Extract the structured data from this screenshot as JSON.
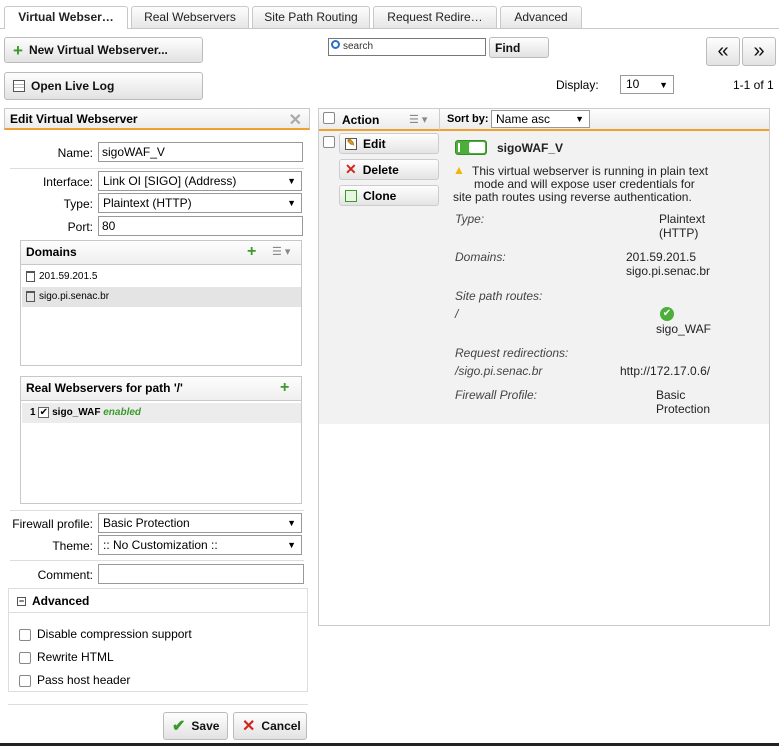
{
  "tabs": [
    {
      "label": "Virtual Webser…",
      "active": true
    },
    {
      "label": "Real Webservers",
      "active": false
    },
    {
      "label": "Site Path Routing",
      "active": false
    },
    {
      "label": "Request Redire…",
      "active": false
    },
    {
      "label": "Advanced",
      "active": false
    }
  ],
  "toolbar": {
    "new_label": "New Virtual Webserver...",
    "search_placeholder": "search",
    "find_label": "Find",
    "prev_label": "«",
    "next_label": "»",
    "live_log_label": "Open Live Log",
    "display_label": "Display:",
    "display_value": "10",
    "range_text": "1-1 of 1"
  },
  "edit": {
    "title": "Edit Virtual Webserver",
    "name_label": "Name:",
    "name_value": "sigoWAF_V",
    "interface_label": "Interface:",
    "interface_value": "Link OI [SIGO] (Address)",
    "type_label": "Type:",
    "type_value": "Plaintext (HTTP)",
    "port_label": "Port:",
    "port_value": "80",
    "domains_title": "Domains",
    "domains": [
      "201.59.201.5",
      "sigo.pi.senac.br"
    ],
    "real_title": "Real Webservers for path '/'",
    "real_index": "1",
    "real_name": "sigo_WAF",
    "real_status": "enabled",
    "firewall_label": "Firewall profile:",
    "firewall_value": "Basic Protection",
    "theme_label": "Theme:",
    "theme_value": ":: No Customization ::",
    "comment_label": "Comment:",
    "comment_value": "",
    "advanced_title": "Advanced",
    "adv_options": [
      "Disable compression support",
      "Rewrite HTML",
      "Pass host header"
    ],
    "save_label": "Save",
    "cancel_label": "Cancel"
  },
  "list": {
    "action_label": "Action",
    "sortby_label": "Sort by:",
    "sortby_value": "Name asc",
    "edit_label": "Edit",
    "delete_label": "Delete",
    "clone_label": "Clone",
    "item_name": "sigoWAF_V",
    "warning": [
      "This virtual webserver is running in plain text",
      "mode and will expose user credentials for",
      "site path routes using reverse authentication."
    ],
    "type_key": "Type:",
    "type_val": [
      "Plaintext",
      "(HTTP)"
    ],
    "domains_key": "Domains:",
    "domains_val": [
      "201.59.201.5",
      "sigo.pi.senac.br"
    ],
    "routes_key": "Site path routes:",
    "route_path": "/",
    "route_target": "sigo_WAF",
    "redir_key": "Request redirections:",
    "redir_from": "/sigo.pi.senac.br",
    "redir_to": "http://172.17.0.6/",
    "fw_key": "Firewall Profile:",
    "fw_val": [
      "Basic",
      "Protection"
    ]
  },
  "colors": {
    "accent": "#f0a030",
    "green": "#3a9a2a",
    "warning": "#f2b600"
  }
}
